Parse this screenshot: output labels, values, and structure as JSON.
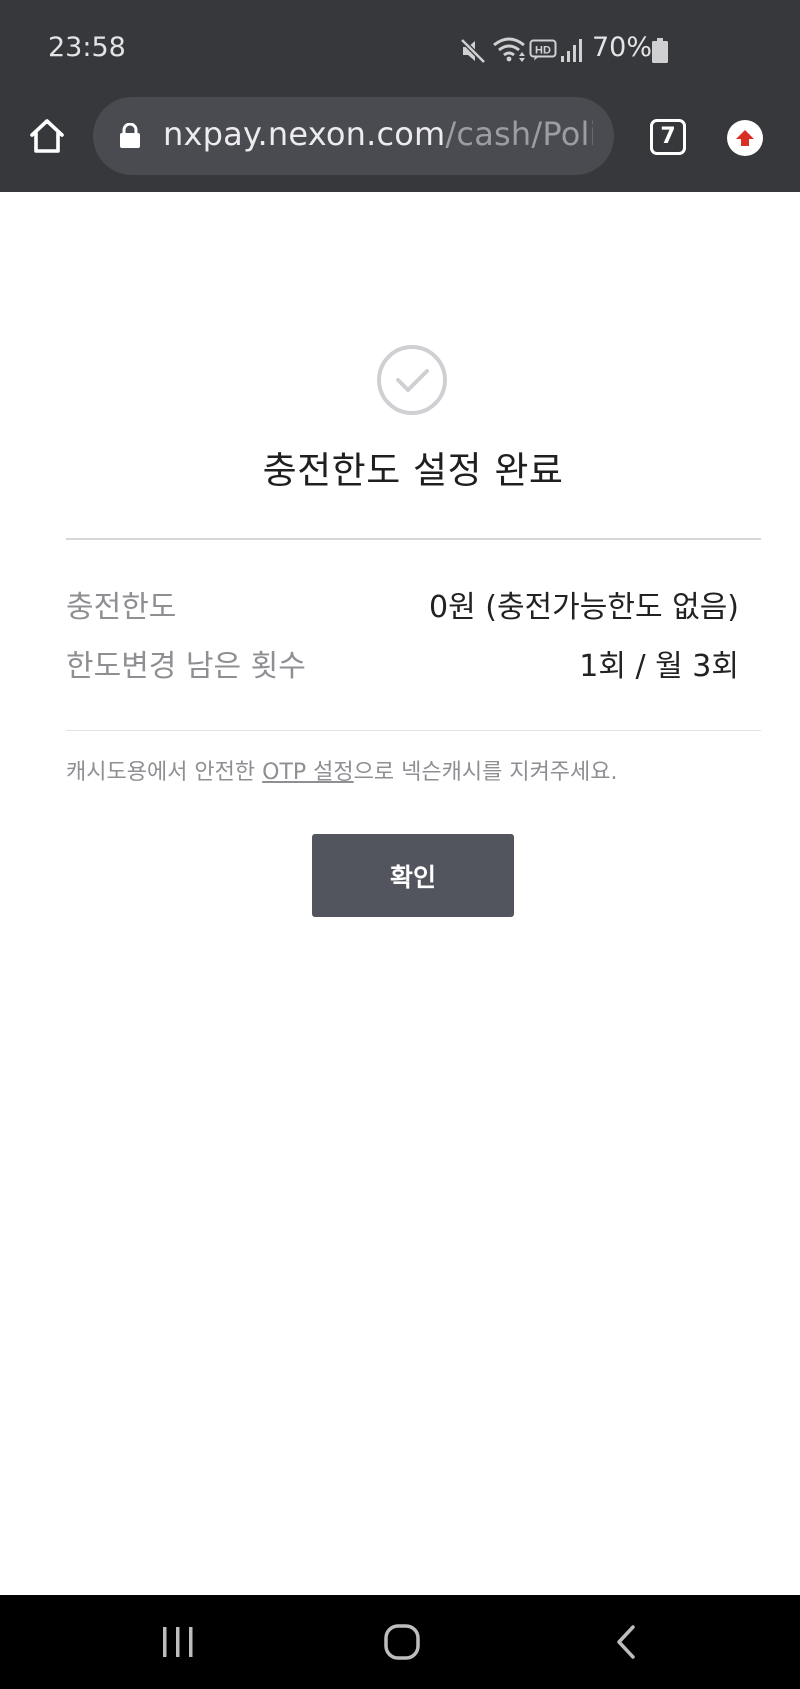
{
  "status_bar": {
    "time": "23:58",
    "battery_percent": "70%",
    "icons": [
      "mute-icon",
      "wifi-icon",
      "hd-icon",
      "signal-icon",
      "battery-icon"
    ]
  },
  "browser": {
    "url_host": "nxpay.nexon.com",
    "url_path": "/cash/Poli",
    "tab_count": "7",
    "icons": [
      "home-icon",
      "lock-icon",
      "update-icon"
    ],
    "colors": {
      "chrome_bg": "#37383c",
      "url_bar_bg": "#4a4b50",
      "update_accent": "#d93025"
    }
  },
  "result": {
    "icon": "check-circle-icon",
    "title": "충전한도 설정 완료",
    "rows": [
      {
        "label": "충전한도",
        "value": "0원 (충전가능한도 없음)"
      },
      {
        "label": "한도변경 남은 횟수",
        "value": "1회 / 월 3회"
      }
    ],
    "notice_before": "캐시도용에서 안전한 ",
    "notice_link": "OTP 설정",
    "notice_after": "으로 넥슨캐시를 지켜주세요.",
    "confirm_label": "확인",
    "colors": {
      "button_bg": "#52555e"
    }
  },
  "navigation": {
    "icons": [
      "recent-apps-icon",
      "home-circle-icon",
      "back-icon"
    ]
  }
}
